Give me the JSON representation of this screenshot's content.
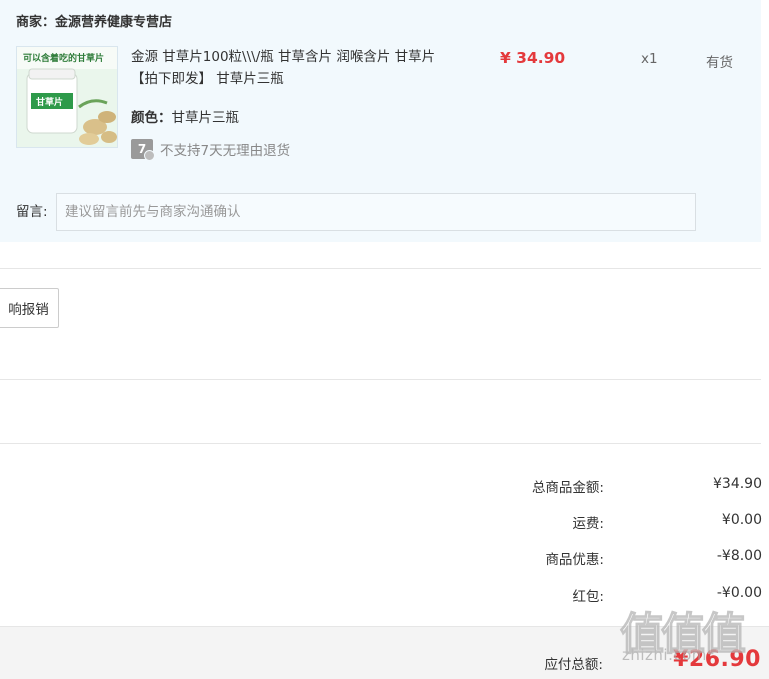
{
  "shop": {
    "name": "商家：金源营养健康专营店"
  },
  "product": {
    "image_caption": "可以含着吃的甘草片",
    "image_label": "甘草片",
    "title": "金源 甘草片100粒\\\\\\/瓶 甘草含片 润喉含片 甘草片【拍下即发】 甘草片三瓶",
    "color_label": "颜色：",
    "color_value": "甘草片三瓶",
    "return_badge": "7",
    "return_policy": "不支持7天无理由退货",
    "price": "¥ 34.90",
    "quantity": "x1",
    "stock": "有货"
  },
  "message": {
    "label": "留言:",
    "placeholder": "建议留言前先与商家沟通确认"
  },
  "invoice": {
    "button_label": "响报销"
  },
  "summary": [
    {
      "label": "总商品金额:",
      "value": "¥34.90"
    },
    {
      "label": "运费:",
      "value": "¥0.00"
    },
    {
      "label": "商品优惠:",
      "value": "-¥8.00"
    },
    {
      "label": "红包:",
      "value": "-¥0.00"
    }
  ],
  "total": {
    "label": "应付总额:",
    "value": "¥26.90"
  },
  "watermark": {
    "glyphs": "值值值",
    "site": "zhizhi.com"
  },
  "colors": {
    "accent_red": "#e4393c",
    "panel_bg": "#f2f9fd",
    "total_bg": "#f4f4f4"
  }
}
